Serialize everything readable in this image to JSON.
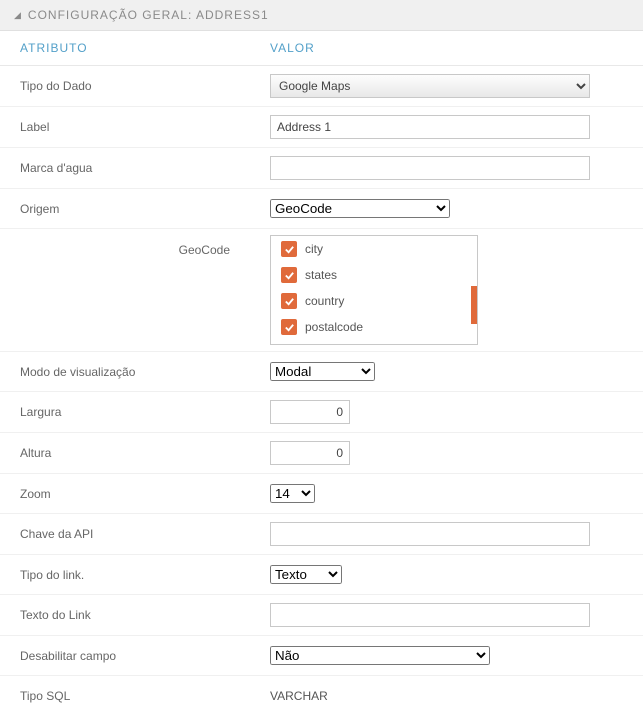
{
  "panel": {
    "title": "CONFIGURAÇÃO GERAL: ADDRESS1"
  },
  "columns": {
    "attr": "ATRIBUTO",
    "val": "VALOR"
  },
  "rows": {
    "tipo_dado": {
      "label": "Tipo do Dado",
      "value": "Google Maps"
    },
    "label_field": {
      "label": "Label",
      "value": "Address 1"
    },
    "marca": {
      "label": "Marca d'agua",
      "value": ""
    },
    "origem": {
      "label": "Origem",
      "value": "GeoCode"
    },
    "geocode": {
      "label": "GeoCode",
      "items": [
        {
          "checked": true,
          "label": "city"
        },
        {
          "checked": true,
          "label": "states"
        },
        {
          "checked": true,
          "label": "country"
        },
        {
          "checked": true,
          "label": "postalcode"
        }
      ]
    },
    "modo": {
      "label": "Modo de visualização",
      "value": "Modal"
    },
    "largura": {
      "label": "Largura",
      "value": "0"
    },
    "altura": {
      "label": "Altura",
      "value": "0"
    },
    "zoom": {
      "label": "Zoom",
      "value": "14"
    },
    "chave": {
      "label": "Chave da API",
      "value": ""
    },
    "tipo_link": {
      "label": "Tipo do link.",
      "value": "Texto"
    },
    "texto_link": {
      "label": "Texto do Link",
      "value": ""
    },
    "desabilitar": {
      "label": "Desabilitar campo",
      "value": "Não"
    },
    "tipo_sql": {
      "label": "Tipo SQL",
      "value": "VARCHAR"
    }
  }
}
